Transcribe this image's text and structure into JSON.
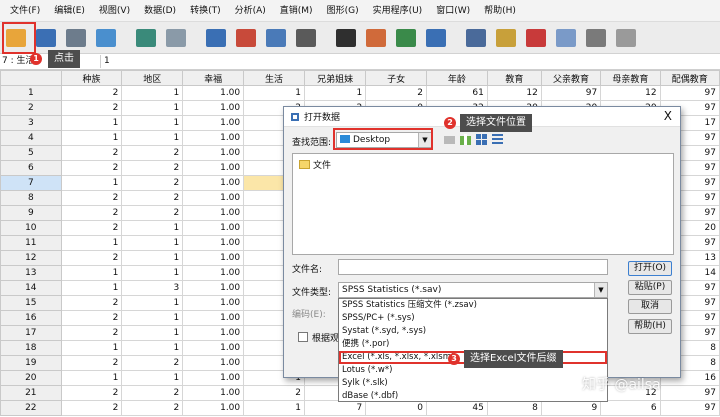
{
  "menubar": {
    "items": [
      "文件(F)",
      "编辑(E)",
      "视图(V)",
      "数据(D)",
      "转换(T)",
      "分析(A)",
      "直销(M)",
      "图形(G)",
      "实用程序(U)",
      "窗口(W)",
      "帮助(H)"
    ]
  },
  "toolbar": {
    "buttons": [
      {
        "name": "open-file",
        "color": "#e8a53a"
      },
      {
        "name": "save",
        "color": "#3b6fb4"
      },
      {
        "name": "print",
        "color": "#6d7c8c"
      },
      {
        "name": "dialog-recall",
        "color": "#4a8fce"
      },
      {
        "name": "undo",
        "color": "#3a8a7a"
      },
      {
        "name": "redo",
        "color": "#8a9aa8"
      },
      {
        "name": "go-to-case",
        "color": "#3a6fb4"
      },
      {
        "name": "go-to-variable",
        "color": "#c84a3a"
      },
      {
        "name": "variables",
        "color": "#4a7ab8"
      },
      {
        "name": "run-descriptives",
        "color": "#5a5a5a"
      },
      {
        "name": "find",
        "color": "#2f2f2f"
      },
      {
        "name": "insert-cases",
        "color": "#d06a3a"
      },
      {
        "name": "insert-variable",
        "color": "#3a8a4a"
      },
      {
        "name": "split-file",
        "color": "#3a6fb4"
      },
      {
        "name": "weight-cases",
        "color": "#4a6a9a"
      },
      {
        "name": "select-cases",
        "color": "#c8a03a"
      },
      {
        "name": "value-labels",
        "color": "#c83a3a"
      },
      {
        "name": "use-sets",
        "color": "#7a9ac8"
      },
      {
        "name": "show-all-variables",
        "color": "#7a7a7a"
      },
      {
        "name": "spelling",
        "color": "#9a9a9a"
      }
    ]
  },
  "editbar": {
    "cell_ref": "7 : 生活",
    "cell_value": "1"
  },
  "grid": {
    "columns": [
      "",
      "种族",
      "地区",
      "幸福",
      "生活",
      "兄弟姐妹",
      "子女",
      "年龄",
      "教育",
      "父亲教育",
      "母亲教育",
      "配偶教育"
    ],
    "rows": [
      [
        "1",
        "2",
        "1",
        "1.00",
        "1",
        "1",
        "2",
        "61",
        "12",
        "97",
        "12",
        "97"
      ],
      [
        "2",
        "2",
        "1",
        "1.00",
        "2",
        "2",
        "0",
        "32",
        "20",
        "20",
        "20",
        "97"
      ],
      [
        "3",
        "1",
        "1",
        "1.00",
        "1",
        "",
        "",
        "",
        "",
        "",
        "",
        "17"
      ],
      [
        "4",
        "1",
        "1",
        "1.00",
        "9",
        "",
        "",
        "",
        "",
        "",
        "",
        "97"
      ],
      [
        "5",
        "2",
        "2",
        "1.00",
        "2",
        "",
        "",
        "",
        "",
        "",
        "",
        "97"
      ],
      [
        "6",
        "2",
        "2",
        "1.00",
        "2",
        "",
        "",
        "",
        "",
        "",
        "",
        "97"
      ],
      [
        "7",
        "1",
        "2",
        "1.00",
        "1",
        "",
        "",
        "",
        "",
        "",
        "",
        "97"
      ],
      [
        "8",
        "2",
        "2",
        "1.00",
        "2",
        "",
        "",
        "",
        "",
        "",
        "",
        "97"
      ],
      [
        "9",
        "2",
        "2",
        "1.00",
        "2",
        "",
        "",
        "",
        "",
        "",
        "",
        "97"
      ],
      [
        "10",
        "2",
        "1",
        "1.00",
        "2",
        "",
        "",
        "",
        "",
        "",
        "",
        "20"
      ],
      [
        "11",
        "1",
        "1",
        "1.00",
        "2",
        "",
        "",
        "",
        "",
        "",
        "",
        "97"
      ],
      [
        "12",
        "2",
        "1",
        "1.00",
        "1",
        "",
        "",
        "",
        "",
        "",
        "",
        "13"
      ],
      [
        "13",
        "1",
        "1",
        "1.00",
        "2",
        "",
        "",
        "",
        "",
        "",
        "",
        "14"
      ],
      [
        "14",
        "1",
        "3",
        "1.00",
        "2",
        "",
        "",
        "",
        "",
        "",
        "",
        "97"
      ],
      [
        "15",
        "2",
        "1",
        "1.00",
        "1",
        "",
        "",
        "",
        "",
        "",
        "",
        "97"
      ],
      [
        "16",
        "2",
        "1",
        "1.00",
        "2",
        "",
        "",
        "",
        "",
        "",
        "",
        "97"
      ],
      [
        "17",
        "2",
        "1",
        "1.00",
        "1",
        "",
        "",
        "",
        "",
        "",
        "",
        "97"
      ],
      [
        "18",
        "1",
        "1",
        "1.00",
        "1",
        "",
        "",
        "",
        "",
        "",
        "",
        "8"
      ],
      [
        "19",
        "2",
        "2",
        "1.00",
        "2",
        "",
        "",
        "",
        "",
        "",
        "",
        "8"
      ],
      [
        "20",
        "1",
        "1",
        "1.00",
        "1",
        "3",
        "",
        "",
        "",
        "",
        "",
        "16"
      ],
      [
        "21",
        "2",
        "2",
        "1.00",
        "2",
        "2",
        "1",
        "37",
        "14",
        "12",
        "12",
        "97"
      ],
      [
        "22",
        "2",
        "2",
        "1.00",
        "1",
        "7",
        "0",
        "45",
        "8",
        "9",
        "6",
        "97"
      ]
    ]
  },
  "dialog": {
    "title": "打开数据",
    "look_in_label": "查找范围:",
    "look_in_value": "Desktop",
    "folder_name": "文件",
    "filename_label": "文件名:",
    "filename_value": "",
    "filetype_label": "文件类型:",
    "filetype_value": "SPSS Statistics (*.sav)",
    "encoding_label": "编码(E):",
    "checkbox_label": "根据观",
    "buttons": {
      "open": "打开(O)",
      "paste": "粘贴(P)",
      "cancel": "取消",
      "help": "帮助(H)"
    },
    "close_glyph": "X",
    "filetype_options": [
      "SPSS Statistics 压缩文件 (*.zsav)",
      "SPSS/PC+ (*.sys)",
      "Systat (*.syd, *.sys)",
      "便携 (*.por)",
      "Excel (*.xls, *.xlsx, *.xlsm)",
      "Lotus (*.w*)",
      "Sylk (*.slk)",
      "dBase (*.dbf)"
    ],
    "selected_option_index": 4
  },
  "callouts": [
    {
      "num": "1",
      "text": "点击"
    },
    {
      "num": "2",
      "text": "选择文件位置"
    },
    {
      "num": "3",
      "text": "选择Excel文件后缀"
    }
  ],
  "watermark": "知乎 @ailsa"
}
